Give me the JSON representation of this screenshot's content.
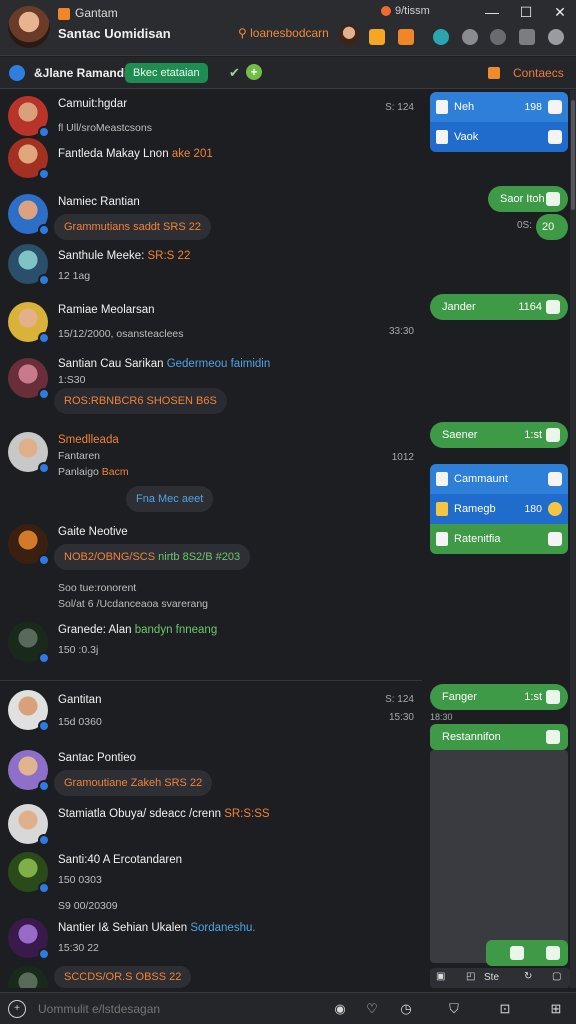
{
  "titlebar": {
    "app_name": "Gantam",
    "title": "Santac Uomidisan",
    "search_text": "loanesbodcarn",
    "app_tag": "9/tissm",
    "window_controls": [
      "—",
      "☐",
      "✕"
    ]
  },
  "subheader": {
    "title": "&Jlane Ramandi",
    "pill": "Bkec etataian",
    "contacts": "Contaecs"
  },
  "chats": [
    {
      "name": "Camuit:hgdar",
      "sub": "fl Ull/sroMeastcsons",
      "time": "S: 124"
    },
    {
      "name": "Fantleda Makay Lnon",
      "name_orange": "ake 201",
      "sub": "",
      "time": ""
    },
    {
      "name": "Namiec Rantian",
      "bubble": "Grammutians saddt",
      "bubble_tail": "SRS 22",
      "time": ""
    },
    {
      "name": "Santhule Meeke:",
      "name_orange": "SR:S 22",
      "sub": "12 1ag",
      "time": ""
    },
    {
      "name": "Ramiae Meolarsan",
      "sub": "15/12/2000, osansteaclees",
      "time": "33:30"
    },
    {
      "name": "Santian Cau Sarikan",
      "name_blue": "Gedermeou faimidin",
      "sub": "1:S30",
      "sub2": "ROS:RBNBCR6 SHOSEN",
      "sub2_tail": "B6S",
      "time": ""
    },
    {
      "name": "Smedlleada",
      "sub": "Fantaren",
      "sub2": "Panlaigo",
      "sub2_tail": "Bacm",
      "bubble": "Fna Mec aeet",
      "time": "1012"
    },
    {
      "name": "Gaite Neotive",
      "bubble": "NOB2/OBNG/SCS",
      "bubble_tail": "nirtb 8S2/B #203",
      "time": ""
    },
    {
      "name": "",
      "sub": "Soo tue:ronorent",
      "sub2": "Sol/at 6 /Ucdanceaoa svarerang",
      "time": ""
    },
    {
      "name": "Granede: Alan",
      "name_blue": "bandyn fnneang",
      "sub": "150 :0.3j",
      "time": ""
    },
    {
      "name": "Gantitan",
      "sub": "15d 0360",
      "time": "S: 124",
      "time2": "15:30"
    },
    {
      "name": "Santac Pontieo",
      "bubble": "Gramoutiane Zakeh",
      "bubble_tail": "SRS 22",
      "time": ""
    },
    {
      "name": "Stamiatla Obuya/ sdeacc /crenn",
      "name_orange": "SR:S:SS",
      "sub": "",
      "time": ""
    },
    {
      "name": "Santi:40 A Ercotandaren",
      "sub": "150 0303",
      "time": ""
    },
    {
      "name": "",
      "sub": "S9 00/20309",
      "time": ""
    },
    {
      "name": "Nantier I& Sehian Ukalen",
      "name_blue": "Sordaneshu.",
      "sub": "15:30 22",
      "time": ""
    },
    {
      "name": "",
      "bubble": "SCCDS/OR.S OBSS 22",
      "time": ""
    }
  ],
  "right_panel": {
    "card1": [
      {
        "label": "Neh",
        "value": "198"
      },
      {
        "label": "Vaok",
        "value": ""
      }
    ],
    "pill1": {
      "label": "Saor Itoh",
      "value": ""
    },
    "pill1_small": {
      "label": "0S:",
      "value": "20"
    },
    "pill2": {
      "label": "Jander",
      "value": "1164"
    },
    "pill3": {
      "label": "Saener",
      "value": "1:st"
    },
    "card2": [
      {
        "label": "Cammaunt",
        "value": ""
      },
      {
        "label": "Ramegb",
        "value": "180"
      },
      {
        "label": "Ratenitfia",
        "value": ""
      }
    ],
    "pill4": {
      "label": "Fanger",
      "value": "1:st"
    },
    "sep_text": "18:30",
    "pill5": {
      "label": "Restannifon",
      "value": ""
    },
    "bottom_label": "Ste"
  },
  "composer": {
    "placeholder": "Uommulit e/lstdesagan"
  },
  "colors": {
    "accent_orange": "#f0833a",
    "green": "#3f9a48",
    "blue": "#2e7fd8",
    "bg": "#1d1e21"
  }
}
